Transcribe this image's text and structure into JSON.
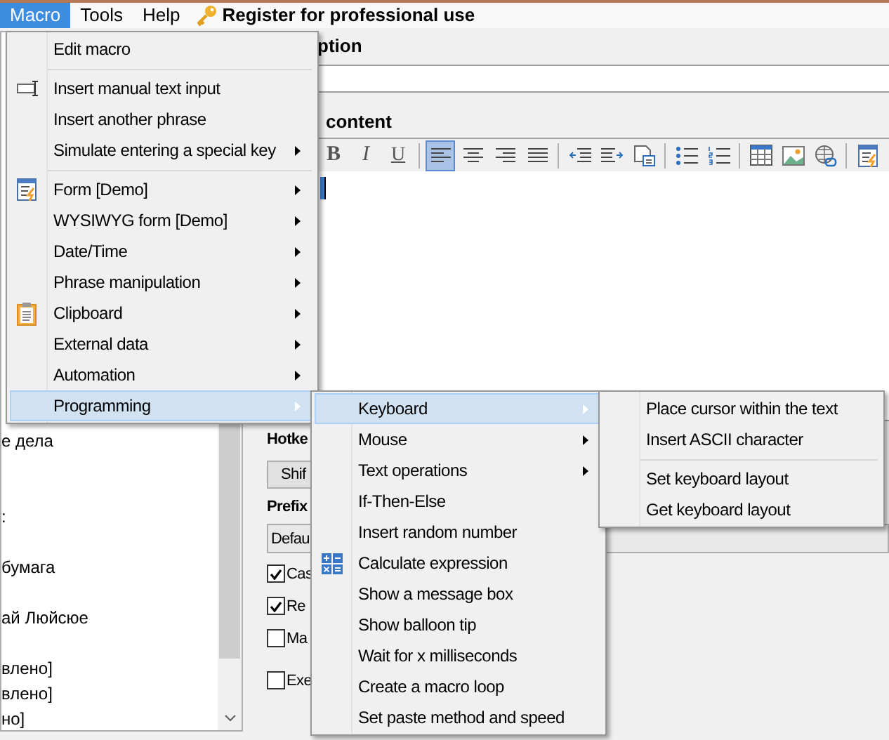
{
  "menubar": {
    "items": [
      {
        "label": "Macro",
        "selected": true
      },
      {
        "label": "Tools",
        "selected": false
      },
      {
        "label": "Help",
        "selected": false
      }
    ],
    "register": "Register for professional use"
  },
  "list": {
    "items": [
      "е дела",
      ":",
      "бумага",
      "ай Люйсюе",
      "влено]",
      "влено]",
      "но]"
    ]
  },
  "editor": {
    "description_label": "ption",
    "content_label": "content",
    "toolbar": [
      {
        "kind": "bold",
        "label": "B"
      },
      {
        "kind": "italic",
        "label": "I"
      },
      {
        "kind": "underline",
        "label": "U",
        "selected": false
      },
      {
        "kind": "separator"
      },
      {
        "kind": "align-left",
        "selected": true
      },
      {
        "kind": "align-center",
        "selected": false
      },
      {
        "kind": "align-right",
        "selected": false
      },
      {
        "kind": "justify",
        "selected": false
      },
      {
        "kind": "separator"
      },
      {
        "kind": "outdent",
        "selected": false
      },
      {
        "kind": "indent",
        "selected": false
      },
      {
        "kind": "document",
        "selected": false
      },
      {
        "kind": "separator"
      },
      {
        "kind": "bullets",
        "selected": false
      },
      {
        "kind": "numbers",
        "selected": false
      },
      {
        "kind": "separator"
      },
      {
        "kind": "table",
        "selected": false
      },
      {
        "kind": "image",
        "selected": false
      },
      {
        "kind": "link",
        "selected": false
      },
      {
        "kind": "separator"
      },
      {
        "kind": "form",
        "selected": false
      }
    ]
  },
  "options": {
    "hotkey_label": "Hotke",
    "hotkey_button": "Shif",
    "prefix_label": "Prefix",
    "prefix_value": "Defau",
    "checkboxes": [
      {
        "label": "Cas",
        "checked": true
      },
      {
        "label": "Re",
        "checked": true
      },
      {
        "label": "Ma",
        "checked": false
      },
      {
        "label": "Exe",
        "checked": false
      }
    ]
  },
  "menus": [
    {
      "items": [
        {
          "kind": "item",
          "label": "Edit macro",
          "submenu": false,
          "selected": false
        },
        {
          "kind": "separator"
        },
        {
          "kind": "text-input",
          "label": "Insert manual text input",
          "submenu": false,
          "selected": false
        },
        {
          "kind": "item",
          "label": "Insert another phrase",
          "submenu": false,
          "selected": false
        },
        {
          "kind": "item",
          "label": "Simulate entering a special key",
          "submenu": true,
          "selected": false
        },
        {
          "kind": "separator"
        },
        {
          "kind": "form",
          "label": "Form [Demo]",
          "submenu": true,
          "selected": false
        },
        {
          "kind": "item",
          "label": "WYSIWYG form [Demo]",
          "submenu": true,
          "selected": false
        },
        {
          "kind": "item",
          "label": "Date/Time",
          "submenu": true,
          "selected": false
        },
        {
          "kind": "item",
          "label": "Phrase manipulation",
          "submenu": true,
          "selected": false
        },
        {
          "kind": "clipboard",
          "label": "Clipboard",
          "submenu": true,
          "selected": false
        },
        {
          "kind": "item",
          "label": "External data",
          "submenu": true,
          "selected": false
        },
        {
          "kind": "item",
          "label": "Automation",
          "submenu": true,
          "selected": false
        },
        {
          "kind": "item",
          "label": "Programming",
          "submenu": true,
          "selected": true
        }
      ]
    },
    {
      "items": [
        {
          "kind": "item",
          "label": "Keyboard",
          "submenu": true,
          "selected": true
        },
        {
          "kind": "item",
          "label": "Mouse",
          "submenu": true,
          "selected": false
        },
        {
          "kind": "item",
          "label": "Text operations",
          "submenu": true,
          "selected": false
        },
        {
          "kind": "item",
          "label": "If-Then-Else",
          "submenu": false,
          "selected": false
        },
        {
          "kind": "item",
          "label": "Insert random number",
          "submenu": false,
          "selected": false
        },
        {
          "kind": "calculator",
          "label": "Calculate expression",
          "submenu": false,
          "selected": false
        },
        {
          "kind": "item",
          "label": "Show a message box",
          "submenu": false,
          "selected": false
        },
        {
          "kind": "item",
          "label": "Show balloon tip",
          "submenu": false,
          "selected": false
        },
        {
          "kind": "item",
          "label": "Wait for x milliseconds",
          "submenu": false,
          "selected": false
        },
        {
          "kind": "item",
          "label": "Create a macro loop",
          "submenu": false,
          "selected": false
        },
        {
          "kind": "item",
          "label": "Set paste method and speed",
          "submenu": false,
          "selected": false
        }
      ]
    },
    {
      "items": [
        {
          "kind": "item",
          "label": "Place cursor within the text",
          "submenu": false,
          "selected": false
        },
        {
          "kind": "item",
          "label": "Insert ASCII character",
          "submenu": false,
          "selected": false
        },
        {
          "kind": "separator"
        },
        {
          "kind": "item",
          "label": "Set keyboard layout",
          "submenu": false,
          "selected": false
        },
        {
          "kind": "item",
          "label": "Get keyboard layout",
          "submenu": false,
          "selected": false
        }
      ]
    }
  ]
}
